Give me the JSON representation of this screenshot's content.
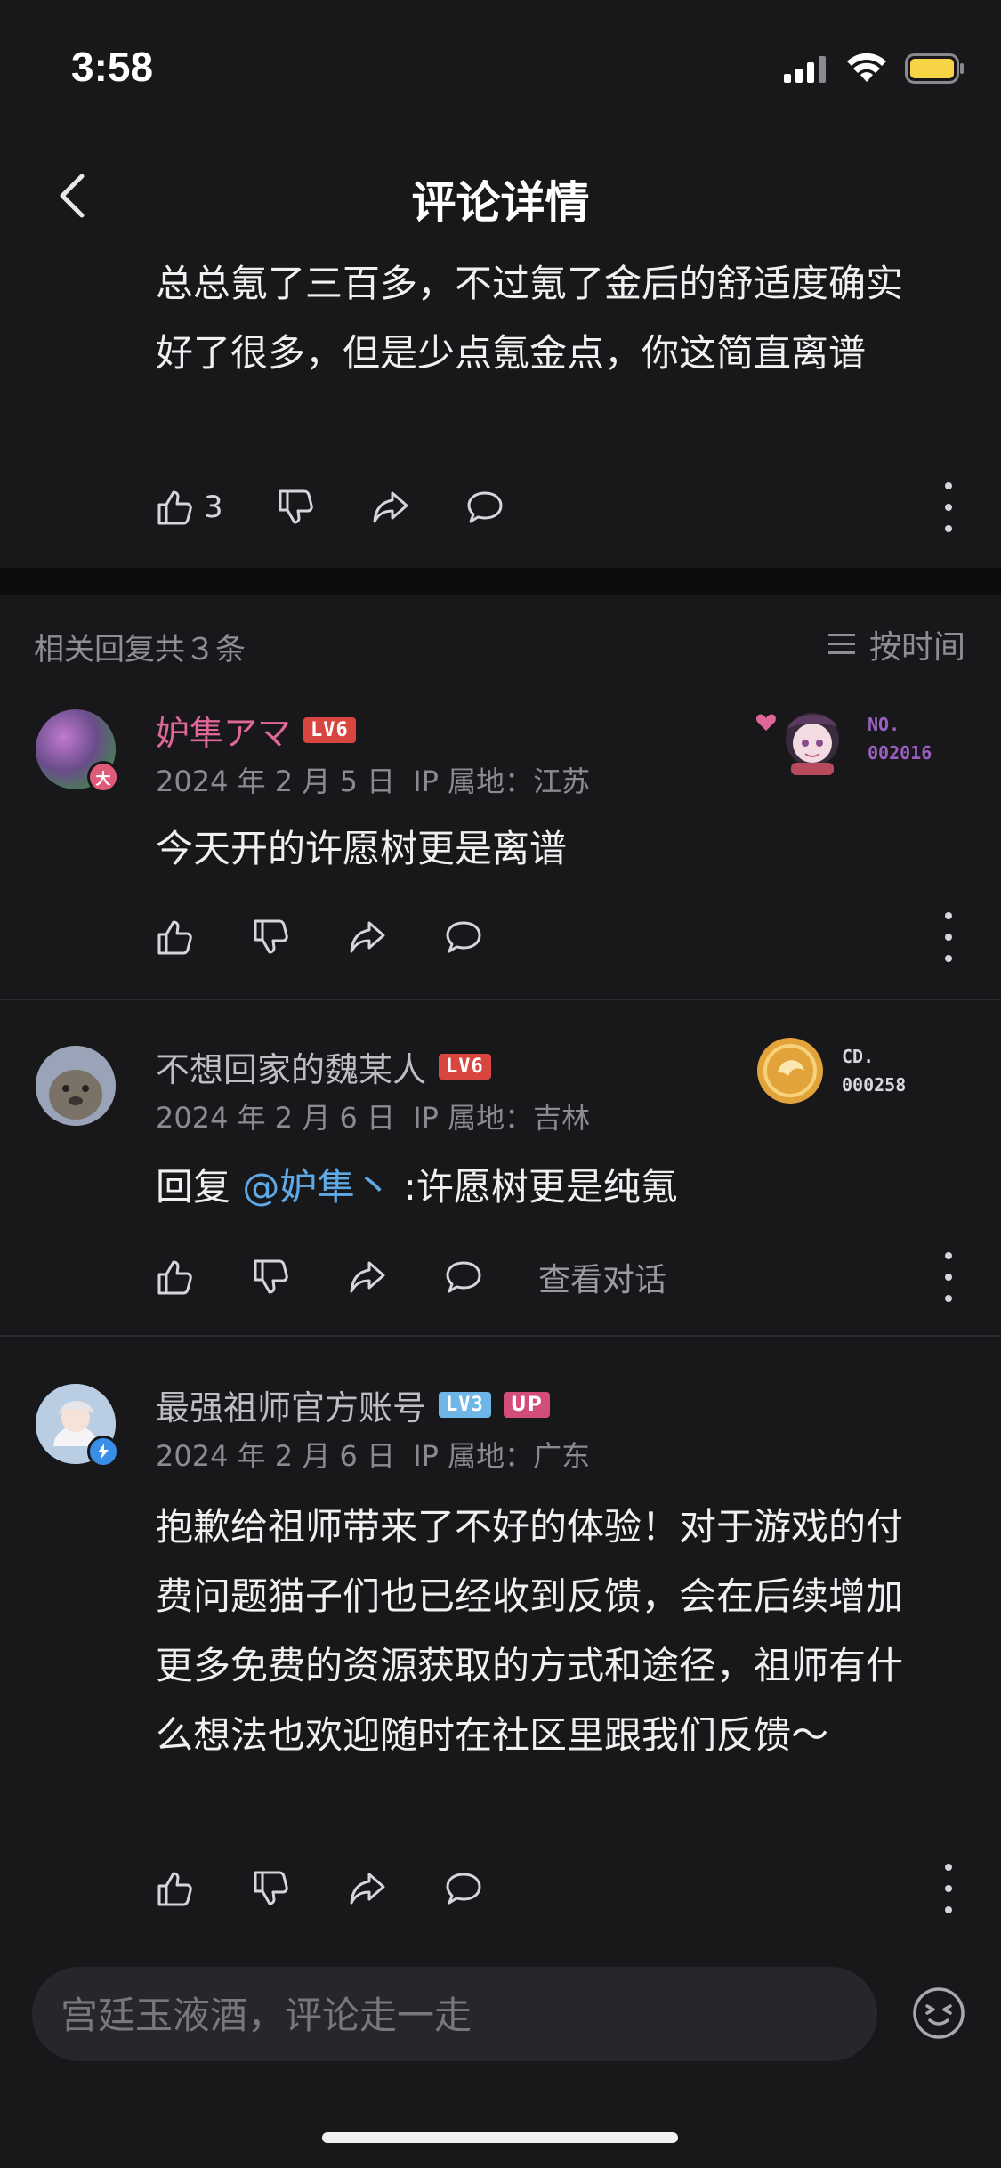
{
  "status_bar": {
    "time": "3:58"
  },
  "nav": {
    "title": "评论详情",
    "back_icon": "chevron-left-icon"
  },
  "original_comment": {
    "text": "总总氪了三百多，不过氪了金后的舒适度确实好了很多，但是少点氪金点，你这简直离谱",
    "likes": "3"
  },
  "replies_header": {
    "count_label": "相关回复共３条",
    "sort_label": "按时间"
  },
  "replies": [
    {
      "username": "妒隼アマ",
      "username_color": "#e0679a",
      "level": "LV6",
      "badge_label": "大",
      "date": "2024 年 2 月 5 日",
      "ip": "IP 属地：江苏",
      "text": "今天开的许愿树更是离谱",
      "decoration_text_1": "NO.",
      "decoration_text_2": "002016"
    },
    {
      "username": "不想回家的魏某人",
      "username_color": "#bdbdc2",
      "level": "LV6",
      "date": "2024 年 2 月 6 日",
      "ip": "IP 属地：吉林",
      "reply_prefix": "回复",
      "mention": "@妒隼丶",
      "text": ":许愿树更是纯氪",
      "view_conversation": "查看对话",
      "decoration_text_1": "CD.",
      "decoration_text_2": "000258"
    },
    {
      "username": "最强祖师官方账号",
      "username_color": "#bdbdc2",
      "level": "LV3",
      "up_badge": "UP",
      "date": "2024 年 2 月 6 日",
      "ip": "IP 属地：广东",
      "text": "抱歉给祖师带来了不好的体验！对于游戏的付费问题猫子们也已经收到反馈，会在后续增加更多免费的资源获取的方式和途径，祖师有什么想法也欢迎随时在社区里跟我们反馈～"
    }
  ],
  "input": {
    "placeholder": "宫廷玉液酒，评论走一走"
  },
  "colors": {
    "background": "#18181b",
    "mention": "#5fa9e6",
    "level_badge": "#d9453f",
    "level3_badge": "#6fb6e8",
    "up_badge": "#d24d7a"
  }
}
